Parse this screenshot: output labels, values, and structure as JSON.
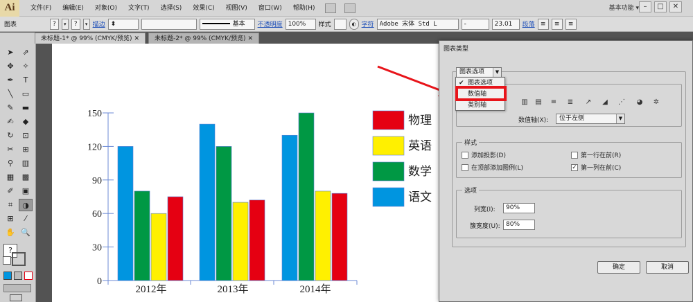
{
  "app": {
    "logo": "Ai"
  },
  "menubar": {
    "items": [
      "文件(F)",
      "编辑(E)",
      "对象(O)",
      "文字(T)",
      "选择(S)",
      "效果(C)",
      "视图(V)",
      "窗口(W)",
      "帮助(H)"
    ],
    "workspace": "基本功能 ▾",
    "window_buttons": [
      "–",
      "□",
      "✕"
    ]
  },
  "controlbar": {
    "object_type": "图表",
    "fill_value": "?",
    "stroke_label": "描边",
    "stroke_value": "⬍",
    "brush_label": "基本",
    "opacity_label": "不透明度",
    "opacity_value": "100%",
    "style_label": "样式",
    "char_label": "字符",
    "font_value": "Adobe 宋体 Std L",
    "style_value": "-",
    "size_value": "23.01",
    "para_label": "段落"
  },
  "tabs": [
    {
      "label": "未标题-1* @ 99% (CMYK/预览)",
      "close": "✕"
    },
    {
      "label": "未标题-2* @ 99% (CMYK/预览)",
      "close": "✕"
    }
  ],
  "tools": {
    "icons": [
      "➤",
      "⇗",
      "✥",
      "✧",
      "✒",
      "T",
      "╲",
      "▭",
      "✎",
      "▬",
      "✍",
      "◆",
      "↻",
      "⊡",
      "✂",
      "⊞",
      "⚲",
      "▥",
      "▦",
      "▩",
      "✐",
      "▣",
      "⌗",
      "◑",
      "⊞",
      "⁄",
      "✋",
      "🔍"
    ],
    "fill_stroke": "?"
  },
  "chart_data": {
    "type": "bar",
    "categories": [
      "2012年",
      "2013年",
      "2014年"
    ],
    "series": [
      {
        "name": "语文",
        "color": "#0095e0",
        "values": [
          120,
          140,
          130
        ]
      },
      {
        "name": "数学",
        "color": "#009844",
        "values": [
          80,
          120,
          150
        ]
      },
      {
        "name": "英语",
        "color": "#fff000",
        "values": [
          60,
          70,
          80
        ]
      },
      {
        "name": "物理",
        "color": "#e50012",
        "values": [
          75,
          72,
          78
        ]
      }
    ],
    "legend_order": [
      "物理",
      "英语",
      "数学",
      "语文"
    ],
    "ylim": [
      0,
      150
    ],
    "yticks": [
      0,
      30,
      60,
      90,
      120,
      150
    ],
    "legend_position": "right"
  },
  "dialog": {
    "title": "图表类型",
    "section_dropdown": "图表选项",
    "menu_items": [
      {
        "label": "图表选项",
        "checked": true
      },
      {
        "label": "数值轴",
        "checked": false
      },
      {
        "label": "类别轴",
        "checked": false
      }
    ],
    "type_icons": [
      "▥",
      "▤",
      "≡",
      "≣",
      "↗",
      "◢",
      "⋰",
      "◕",
      "✲"
    ],
    "value_axis_label": "数值轴(X):",
    "value_axis_value": "位于左侧",
    "style_group": "样式",
    "checkboxes": [
      {
        "label": "添加投影(D)",
        "checked": false
      },
      {
        "label": "第一行在前(R)",
        "checked": false
      },
      {
        "label": "在顶部添加图例(L)",
        "checked": false
      },
      {
        "label": "第一列在前(C)",
        "checked": true
      }
    ],
    "options_group": "选项",
    "column_width_label": "列宽(I):",
    "column_width_value": "90%",
    "cluster_width_label": "簇宽度(U):",
    "cluster_width_value": "80%",
    "ok_label": "确定",
    "cancel_label": "取消"
  }
}
